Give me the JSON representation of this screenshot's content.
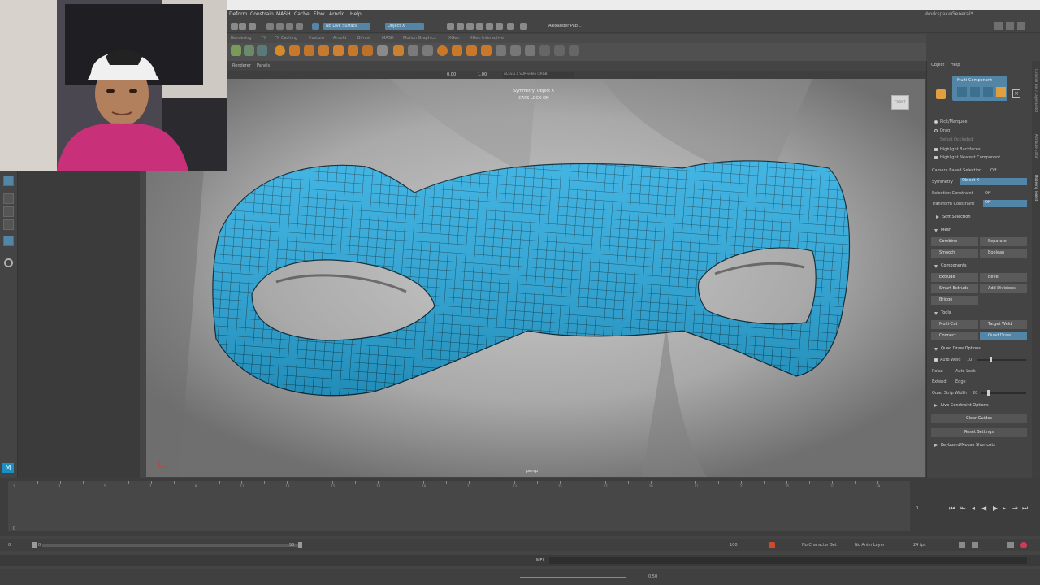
{
  "app": {
    "workspace_label": "Workspace :",
    "workspace_value": "General*",
    "colors": {
      "accent": "#5285a6",
      "mesh": "#29abe0",
      "mesh_edge": "#0b2a38"
    }
  },
  "menubar": [
    "Deform",
    "Constrain",
    "MASH",
    "Cache",
    "Flow",
    "Arnold",
    "Help"
  ],
  "statusline": {
    "no_live_surface": "No Live Surface",
    "symmetry_field": "Object X",
    "user": "Alexander Pab..."
  },
  "shelf_tabs": [
    "Rendering",
    "FX",
    "FX Caching",
    "Custom",
    "Arnold",
    "Bifrost",
    "MASH",
    "Motion Graphics",
    "XGen",
    "XGen Interactive"
  ],
  "viewport": {
    "menu": [
      "Renderer",
      "Panels"
    ],
    "gamma_value": "0.00",
    "exposure_value": "1.00",
    "colorspace": "ACES 1.0 SDR-video (sRGB)",
    "hud_symmetry": "Symmetry: Object X",
    "hud_caps": "CAPS LOCK ON",
    "camera_label": "persp",
    "view_cube": "FRONT"
  },
  "modeling_toolkit": {
    "tabs": [
      "Object",
      "Help"
    ],
    "mode_label": "Multi-Component",
    "pick_marquee": "Pick/Marquee",
    "drag": "Drag",
    "select_in_view": "Select Occluded",
    "highlight_backfaces": "Highlight Backfaces",
    "highlight_nearest": "Highlight Nearest Component",
    "camera_based_selection": "Camera Based Selection",
    "camera_based_value": "Off",
    "symmetry_label": "Symmetry",
    "symmetry_value": "Object X",
    "selection_constraint": "Selection Constraint",
    "selection_constraint_value": "Off",
    "transform_constraint": "Transform Constraint",
    "transform_constraint_value": "Off",
    "soft_selection": "Soft Selection",
    "mesh_header": "Mesh",
    "components_header": "Components",
    "tools_header": "Tools",
    "mesh_buttons": [
      "Combine",
      "Separate",
      "Smooth",
      "Boolean"
    ],
    "component_buttons": [
      "Extrude",
      "Bevel",
      "Bridge",
      "Add Divisions"
    ],
    "component_button_extra": "Smart Extrude",
    "tool_buttons": [
      "Multi-Cut",
      "Target Weld",
      "Connect",
      "Quad Draw"
    ],
    "quad_draw_options": "Quad Draw Options",
    "auto_weld": "Auto Weld",
    "auto_weld_value": "10",
    "relax": "Relax",
    "relax_value": "Auto Lock",
    "extend": "Extend",
    "extend_value": "Edge",
    "quad_strip_width": "Quad Strip Width",
    "quad_strip_value": "20",
    "live_constraint_options": "Live Constraint Options",
    "clear_guides": "Clear Guides",
    "reset_settings": "Reset Settings",
    "keyboard_shortcuts": "Keyboard/Mouse Shortcuts",
    "side_tabs": [
      "Channel Box / Layer Editor",
      "Attribute Editor",
      "Modeling Toolkit"
    ]
  },
  "timeline": {
    "ticks": [
      "1",
      "2",
      "3",
      "4",
      "5",
      "6",
      "7",
      "8",
      "9",
      "10",
      "11",
      "12",
      "13",
      "14",
      "15",
      "16",
      "17",
      "18",
      "19",
      "20",
      "21",
      "22",
      "23",
      "24",
      "25",
      "26",
      "27",
      "28",
      "29",
      "30",
      "31",
      "32",
      "33",
      "34",
      "35",
      "36",
      "37",
      "38",
      "39"
    ],
    "current_frame": "0",
    "range_start": "0",
    "range_inner_start": "0",
    "range_inner_end": "50",
    "range_end": "100",
    "no_character_set": "No Character Set",
    "no_anim_layer": "No Anim Layer",
    "fps": "24 fps",
    "cmd_label": "MEL",
    "zoom_value": "0.50"
  }
}
